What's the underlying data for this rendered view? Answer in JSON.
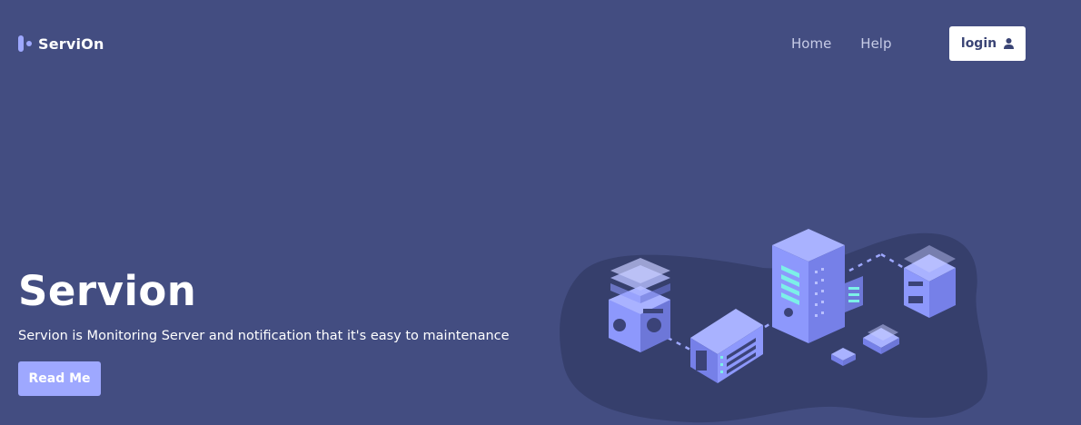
{
  "header": {
    "logo_text": "ServiOn",
    "nav": [
      {
        "label": "Home"
      },
      {
        "label": "Help"
      }
    ],
    "login_label": "login"
  },
  "hero": {
    "title": "Servion",
    "subtitle": "Servion is Monitoring Server and notification that it's easy to maintenance",
    "cta_label": "Read Me"
  },
  "icons": {
    "logo": "servion-logo-icon",
    "login": "user-icon",
    "illustration": "server-network-illustration"
  },
  "colors": {
    "background": "#434d81",
    "accent": "#9ea8ff",
    "blob": "#363f6c",
    "server": "#8f9afc",
    "white": "#ffffff"
  }
}
